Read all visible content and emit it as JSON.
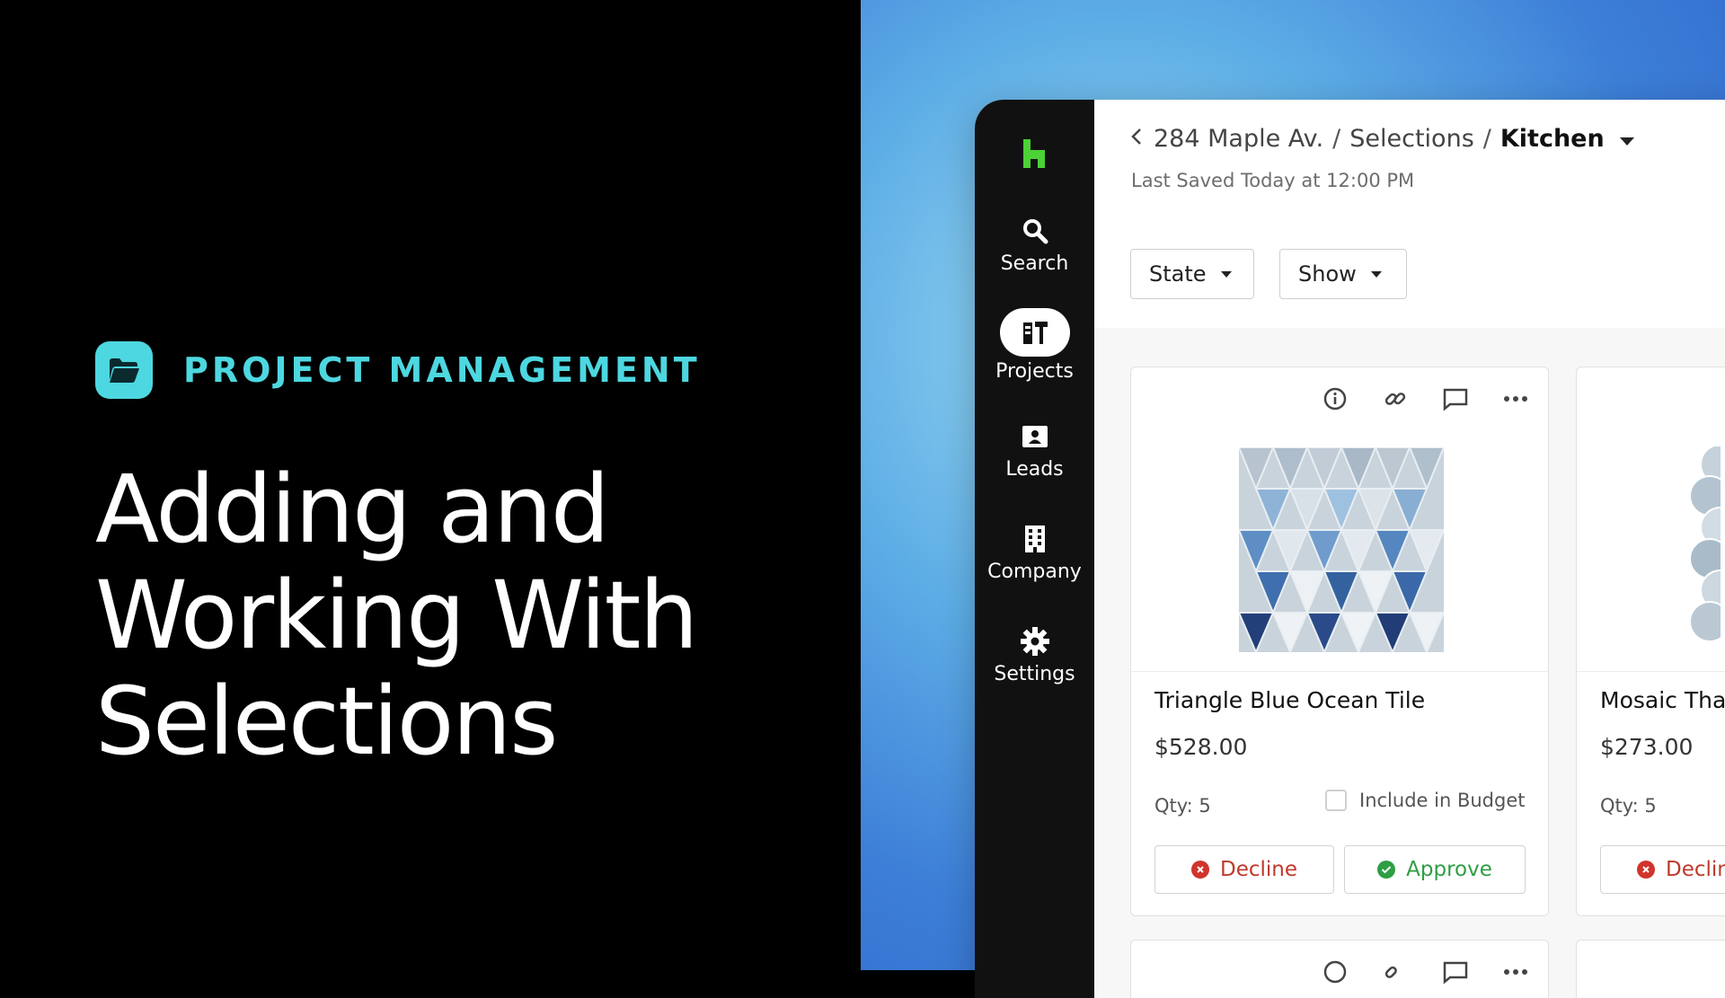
{
  "promo": {
    "category": "PROJECT MANAGEMENT",
    "headline": [
      "Adding and",
      "Working With",
      "Selections"
    ],
    "accent_color": "#4dd7e0",
    "category_icon": "folder-open-icon"
  },
  "sidebar": {
    "logo": "houzz-logo",
    "items": [
      {
        "label": "Search",
        "icon": "search-icon",
        "active": false
      },
      {
        "label": "Projects",
        "icon": "projects-tools-icon",
        "active": true
      },
      {
        "label": "Leads",
        "icon": "contact-card-icon",
        "active": false
      },
      {
        "label": "Company",
        "icon": "building-icon",
        "active": false
      },
      {
        "label": "Settings",
        "icon": "gear-icon",
        "active": false
      }
    ]
  },
  "header": {
    "breadcrumb": [
      "284 Maple Av.",
      "Selections",
      "Kitchen"
    ],
    "saved": "Last Saved Today at 12:00 PM"
  },
  "filters": {
    "state_label": "State",
    "show_label": "Show"
  },
  "cards": [
    {
      "title": "Triangle Blue Ocean Tile",
      "price": "$528.00",
      "qty": "Qty: 5",
      "budget_label": "Include in Budget",
      "decline_label": "Decline",
      "approve_label": "Approve"
    },
    {
      "title": "Mosaic Tha",
      "price": "$273.00",
      "qty": "Qty: 5",
      "decline_label": "Declin"
    }
  ],
  "colors": {
    "brand_green": "#4cd137",
    "decline_red": "#d0342c",
    "approve_green": "#2f9e44",
    "sidebar_bg": "#111111"
  }
}
